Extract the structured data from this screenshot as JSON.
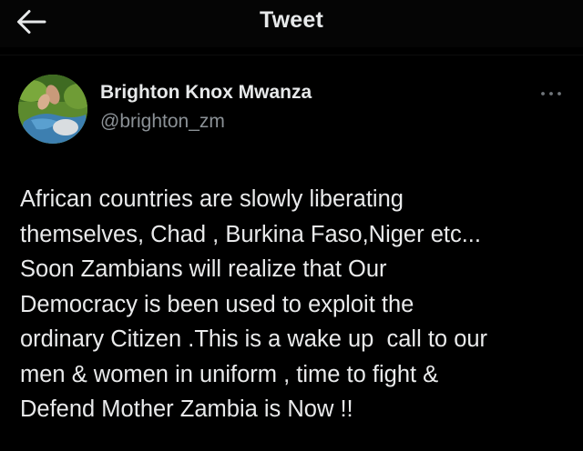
{
  "header": {
    "title": "Tweet",
    "back_icon": "arrow-left-icon"
  },
  "author": {
    "name": "Brighton Knox Mwanza",
    "handle": "@brighton_zm",
    "avatar_icon": "profile-photo"
  },
  "more_icon": "more-dots-icon",
  "tweet": {
    "lines": [
      "African countries are slowly liberating",
      "themselves, Chad , Burkina Faso,Niger etc...",
      "Soon Zambians will realize that Our",
      "Democracy is been used to exploit the",
      "ordinary Citizen .This is a wake up  call to our",
      "men & women in uniform , time to fight &",
      "Defend Mother Zambia is Now !!"
    ]
  },
  "colors": {
    "background": "#000000",
    "text_primary": "#e7e9ea",
    "text_secondary": "#8b9196"
  }
}
